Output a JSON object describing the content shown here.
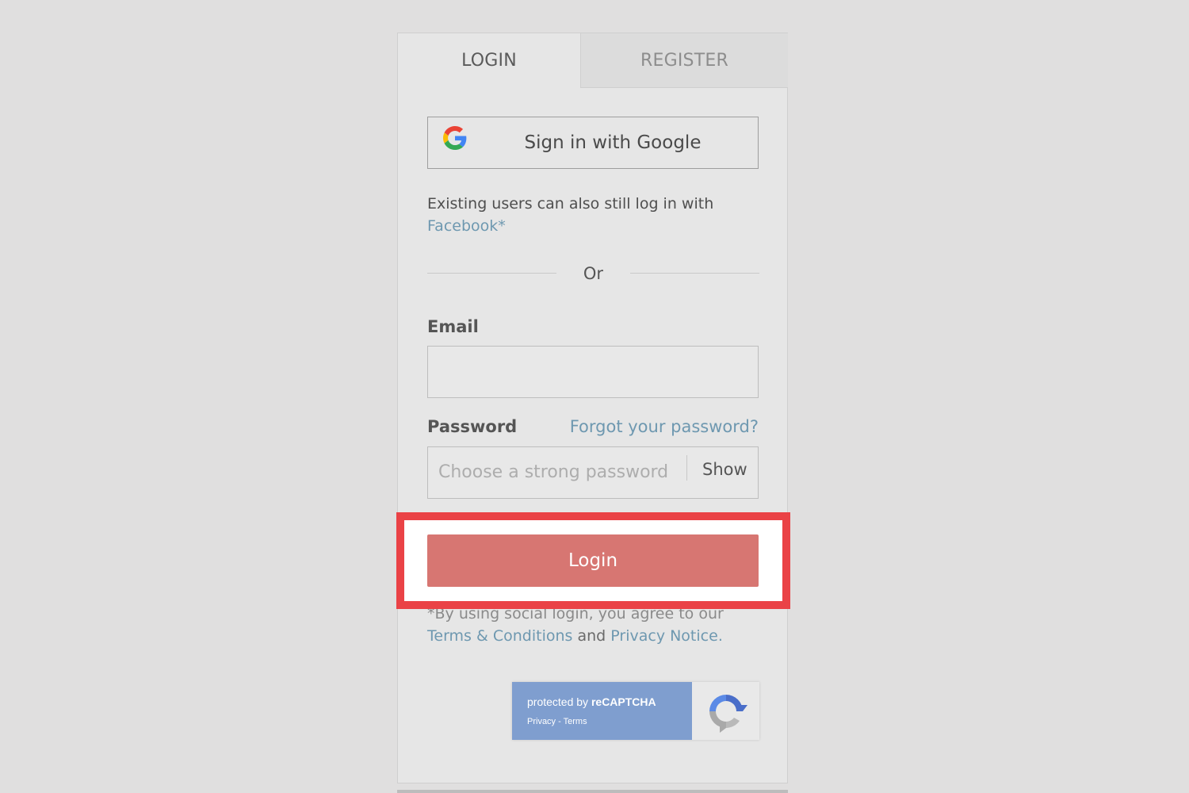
{
  "tabs": {
    "login": "LOGIN",
    "register": "REGISTER"
  },
  "google": {
    "label": "Sign in with Google"
  },
  "existing": {
    "text": "Existing users can also still log in with",
    "facebook": "Facebook*"
  },
  "divider": {
    "or": "Or"
  },
  "email": {
    "label": "Email",
    "value": "",
    "placeholder": ""
  },
  "password": {
    "label": "Password",
    "forgot": "Forgot your password?",
    "placeholder": "Choose a strong password",
    "show": "Show"
  },
  "login_button": {
    "label": "Login"
  },
  "disclaimer": {
    "line1": "*By using social login, you agree to our",
    "terms": "Terms & Conditions",
    "and": "and",
    "privacy": "Privacy Notice",
    "period": "."
  },
  "recaptcha": {
    "prefix": "protected by",
    "brand": "reCAPTCHA",
    "privacy": "Privacy",
    "sep": " - ",
    "terms": "Terms"
  },
  "colors": {
    "login_button": "#d77672",
    "link": "#6e98b0",
    "highlight": "#ea4246",
    "recaptcha": "#7f9ecf"
  }
}
